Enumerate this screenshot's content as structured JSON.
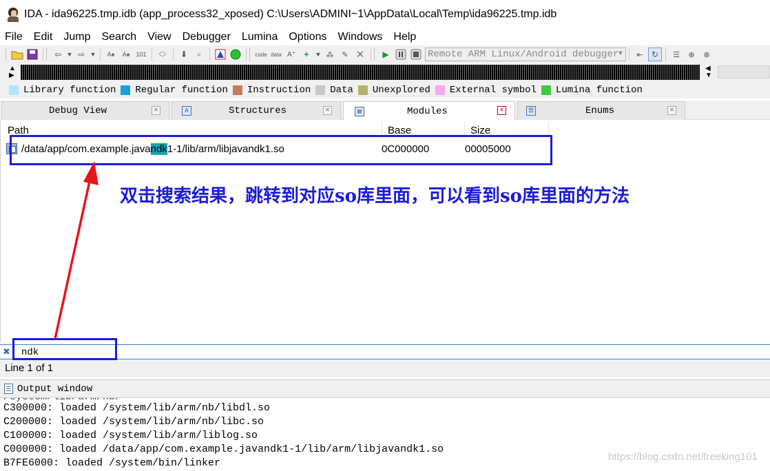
{
  "window": {
    "title": "IDA - ida96225.tmp.idb (app_process32_xposed) C:\\Users\\ADMINI~1\\AppData\\Local\\Temp\\ida96225.tmp.idb"
  },
  "menu": [
    "File",
    "Edit",
    "Jump",
    "Search",
    "View",
    "Debugger",
    "Lumina",
    "Options",
    "Windows",
    "Help"
  ],
  "toolbar": {
    "debugger_select": "Remote ARM Linux/Android debugger"
  },
  "legend": [
    {
      "label": "Library function",
      "color": "#aee8f8"
    },
    {
      "label": "Regular function",
      "color": "#1aa0e0"
    },
    {
      "label": "Instruction",
      "color": "#c87a56"
    },
    {
      "label": "Data",
      "color": "#c8c8c8"
    },
    {
      "label": "Unexplored",
      "color": "#b6b06e"
    },
    {
      "label": "External symbol",
      "color": "#f8a8f0"
    },
    {
      "label": "Lumina function",
      "color": "#3ccc3c"
    }
  ],
  "tabs": [
    "Debug View",
    "Structures",
    "Modules",
    "Enums"
  ],
  "modules": {
    "columns": [
      "Path",
      "Base",
      "Size"
    ],
    "row": {
      "path_pre": "/data/app/com.example.java",
      "path_match": "ndk",
      "path_post": "1-1/lib/arm/libjavandk1.so",
      "base": "0C000000",
      "size": "00005000"
    }
  },
  "annotation": {
    "text": "双击搜索结果，跳转到对应so库里面，可以看到so库里面的方法"
  },
  "filter": {
    "value": "ndk"
  },
  "status": "Line 1 of 1",
  "output": {
    "title": "Output window",
    "lines": [
      "C300000: loaded /system/lib/arm/nb/libdl.so",
      "C200000: loaded /system/lib/arm/nb/libc.so",
      "C100000: loaded /system/lib/arm/liblog.so",
      "C000000: loaded /data/app/com.example.javandk1-1/lib/arm/libjavandk1.so",
      "B7FE6000: loaded /system/bin/linker"
    ]
  },
  "watermark": "https://blog.csdn.net/freeking101"
}
